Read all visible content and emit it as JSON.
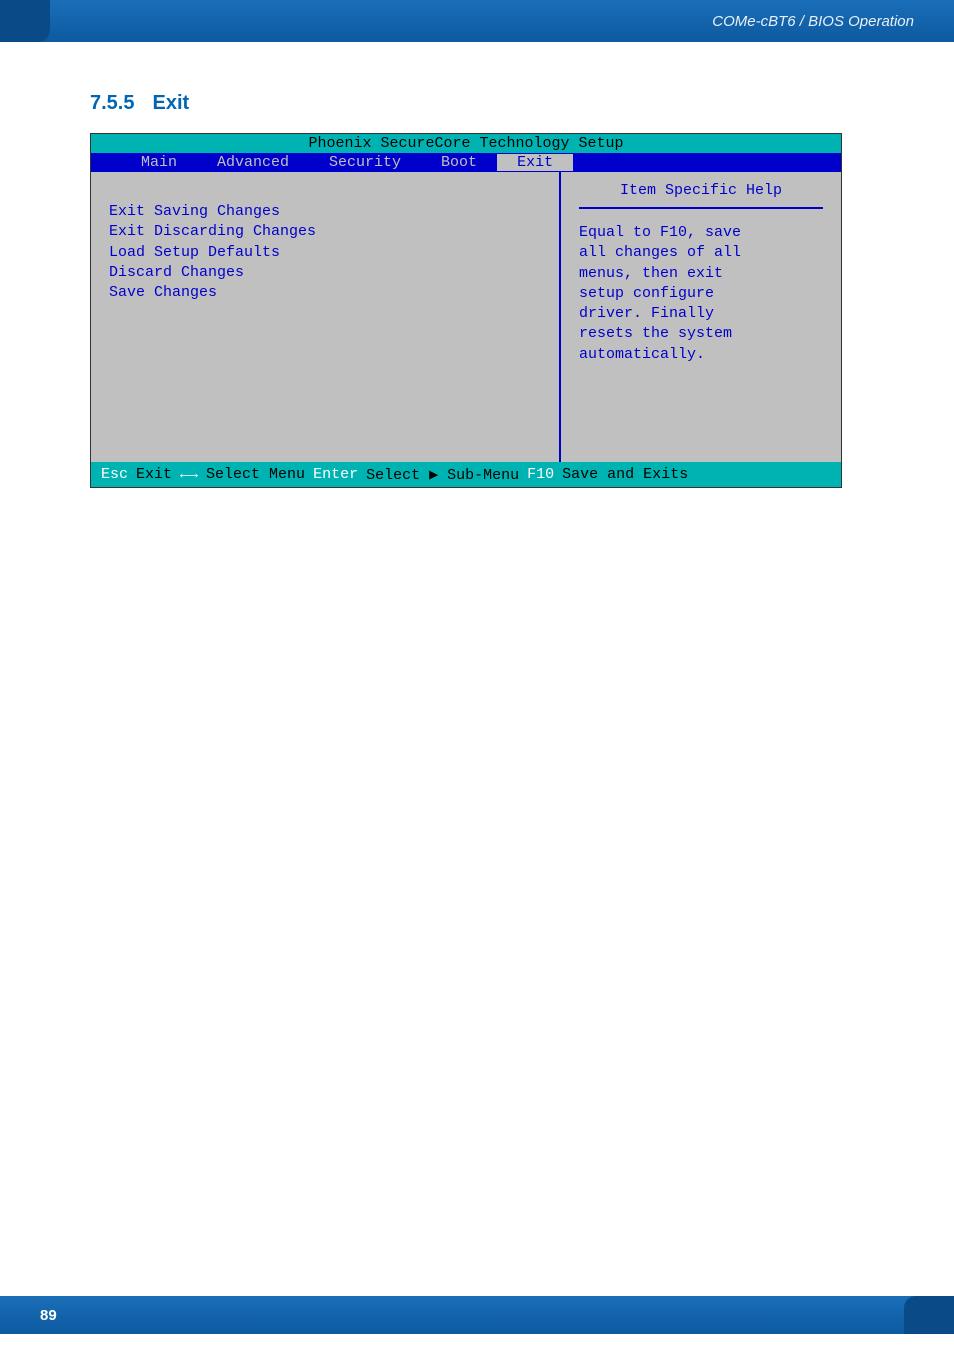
{
  "header": {
    "breadcrumb": "COMe-cBT6 / BIOS Operation"
  },
  "section": {
    "number": "7.5.5",
    "title": "Exit"
  },
  "bios": {
    "title": "Phoenix SecureCore Technology Setup",
    "tabs": {
      "main": "Main",
      "advanced": "Advanced",
      "security": "Security",
      "boot": "Boot",
      "exit": "Exit"
    },
    "menu": {
      "item1": "Exit Saving Changes",
      "item2": "Exit Discarding Changes",
      "item3": "Load Setup Defaults",
      "item4": "Discard Changes",
      "item5": "Save Changes"
    },
    "help": {
      "title": "Item Specific Help",
      "text": "Equal to F10,  save\nall changes of all\nmenus, then exit\nsetup configure\ndriver. Finally\nresets the system\nautomatically."
    },
    "footer": {
      "esc_key": "Esc",
      "esc_label": "Exit",
      "arrows_key": "←→",
      "arrows_label": "Select Menu",
      "enter_key": "Enter",
      "enter_label": "Select ▶ Sub-Menu",
      "f10_key": "F10",
      "f10_label": "Save and Exits"
    }
  },
  "footer": {
    "page_number": "89"
  }
}
